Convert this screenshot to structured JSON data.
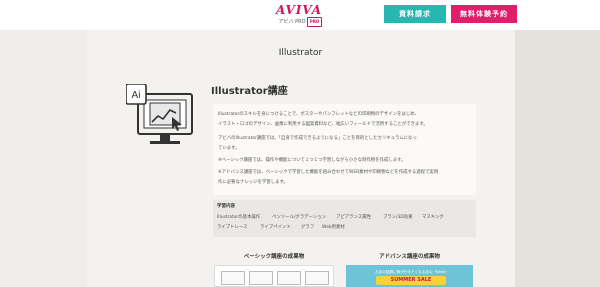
{
  "header": {
    "logo_word": "AVIVA",
    "logo_sub": "アビバ PRO",
    "logo_badge": "PRO",
    "buttons": {
      "docs": "資料請求",
      "trial": "無料体験予約"
    }
  },
  "page": {
    "title": "Illustrator"
  },
  "course": {
    "icon_label": "Ai",
    "title": "Illustrator講座",
    "description": [
      "Illustratorのスキルを身につけることで、ポスターやパンフレットなどの印刷物のデザインをはじめ、",
      "イラスト・ロゴのデザイン、画像に利用する図案資料など、幅広いフィールドで活用することができます。",
      "アビバのIllustrator講座では、「自身で作成できるようになる」ことを目的としたカリキュラムになっ",
      "ています。",
      "※ベーシック講座では、操作や機能について１つ１つ学習しながら小さな制作物を作成します。",
      "※アドバンス講座では、ベーシックで学習した機能を組み合わせてWEB素材や印刷物などを作成する過程で実例",
      "作に必要なナレッジを学習します。"
    ]
  },
  "topics": {
    "heading": "学習内容",
    "row1": [
      "Illustratorの基本操作",
      "ペンツール/グラデーション",
      "アピアランス属性",
      "ブラシ/3D効果",
      "マスキング"
    ],
    "row2": [
      "ライブトレース",
      "ライブペイント",
      "グラフ",
      "Web用素材"
    ]
  },
  "results": {
    "basic_heading": "ベーシック講座の成果物",
    "advance_heading": "アドバンス講座の成果物",
    "advance_caption": "お店の話題に飾が行きたくなるあの「Web!!",
    "advance_banner": "SUMMER SALE"
  },
  "colors": {
    "brand": "#d6125f",
    "docs_button": "#26b8b0",
    "trial_button": "#e21d6c",
    "advance_thumb": "#6fc3d8"
  }
}
